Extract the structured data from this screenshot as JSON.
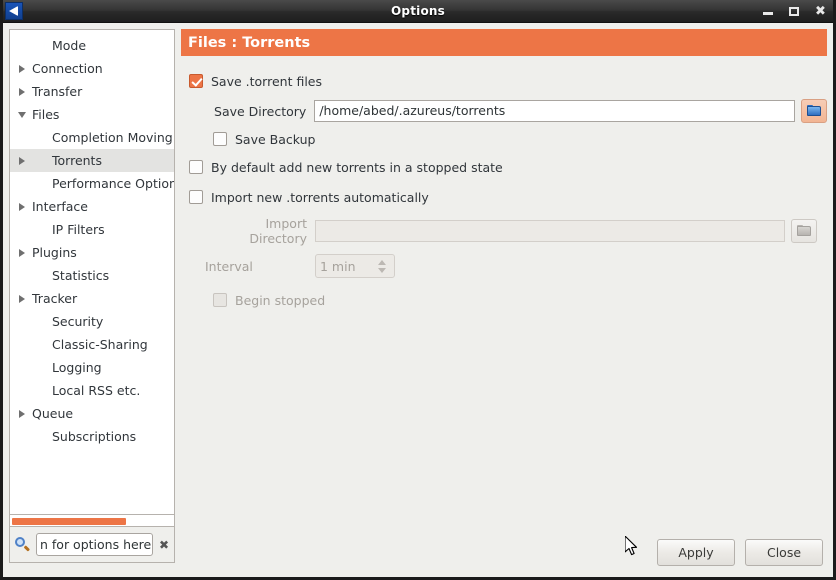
{
  "window": {
    "title": "Options",
    "app_icon": "vuze-logo-icon",
    "controls": {
      "minimize": "minimize-icon",
      "maximize": "maximize-icon",
      "close": "close-icon"
    }
  },
  "sidebar": {
    "items": [
      {
        "label": "Mode",
        "expander": "none",
        "indent": 1,
        "selected": false
      },
      {
        "label": "Connection",
        "expander": "right",
        "indent": 0,
        "selected": false
      },
      {
        "label": "Transfer",
        "expander": "right",
        "indent": 0,
        "selected": false
      },
      {
        "label": "Files",
        "expander": "down",
        "indent": 0,
        "selected": false
      },
      {
        "label": "Completion Moving",
        "expander": "none",
        "indent": 1,
        "selected": false
      },
      {
        "label": "Torrents",
        "expander": "right",
        "indent": 1,
        "selected": true
      },
      {
        "label": "Performance Options",
        "expander": "none",
        "indent": 1,
        "selected": false
      },
      {
        "label": "Interface",
        "expander": "right",
        "indent": 0,
        "selected": false
      },
      {
        "label": "IP Filters",
        "expander": "none",
        "indent": 1,
        "selected": false
      },
      {
        "label": "Plugins",
        "expander": "right",
        "indent": 0,
        "selected": false
      },
      {
        "label": "Statistics",
        "expander": "none",
        "indent": 1,
        "selected": false
      },
      {
        "label": "Tracker",
        "expander": "right",
        "indent": 0,
        "selected": false
      },
      {
        "label": "Security",
        "expander": "none",
        "indent": 1,
        "selected": false
      },
      {
        "label": "Classic-Sharing",
        "expander": "none",
        "indent": 1,
        "selected": false
      },
      {
        "label": "Logging",
        "expander": "none",
        "indent": 1,
        "selected": false
      },
      {
        "label": "Local RSS etc.",
        "expander": "none",
        "indent": 1,
        "selected": false
      },
      {
        "label": "Queue",
        "expander": "right",
        "indent": 0,
        "selected": false
      },
      {
        "label": "Subscriptions",
        "expander": "none",
        "indent": 1,
        "selected": false
      }
    ],
    "scrollbar": {
      "orientation": "horizontal",
      "thumb_percent": 72
    },
    "search": {
      "icon": "search-icon",
      "value": "n for options here",
      "placeholder": "Search for options here",
      "clear_icon": "clear-icon"
    }
  },
  "main": {
    "header": "Files : Torrents",
    "save_torrent_files": {
      "label": "Save .torrent files",
      "checked": true
    },
    "save_directory": {
      "label": "Save Directory",
      "value": "/home/abed/.azureus/torrents",
      "browse_icon": "folder-icon"
    },
    "save_backup": {
      "label": "Save Backup",
      "checked": false
    },
    "default_stopped": {
      "label": "By default add new torrents in a stopped state",
      "checked": false
    },
    "import_auto": {
      "label": "Import new .torrents automatically",
      "checked": false
    },
    "import_directory": {
      "label": "Import Directory",
      "value": "",
      "browse_icon": "folder-icon",
      "disabled": true
    },
    "interval": {
      "label": "Interval",
      "value": "1 min",
      "disabled": true
    },
    "begin_stopped": {
      "label": "Begin stopped",
      "checked": false,
      "disabled": true
    }
  },
  "footer": {
    "apply_label": "Apply",
    "close_label": "Close"
  },
  "colors": {
    "accent_orange": "#ed7546",
    "titlebar_dark": "#2a2a2a",
    "panel_bg": "#efefec",
    "selection_gray": "#e3e3e1"
  }
}
